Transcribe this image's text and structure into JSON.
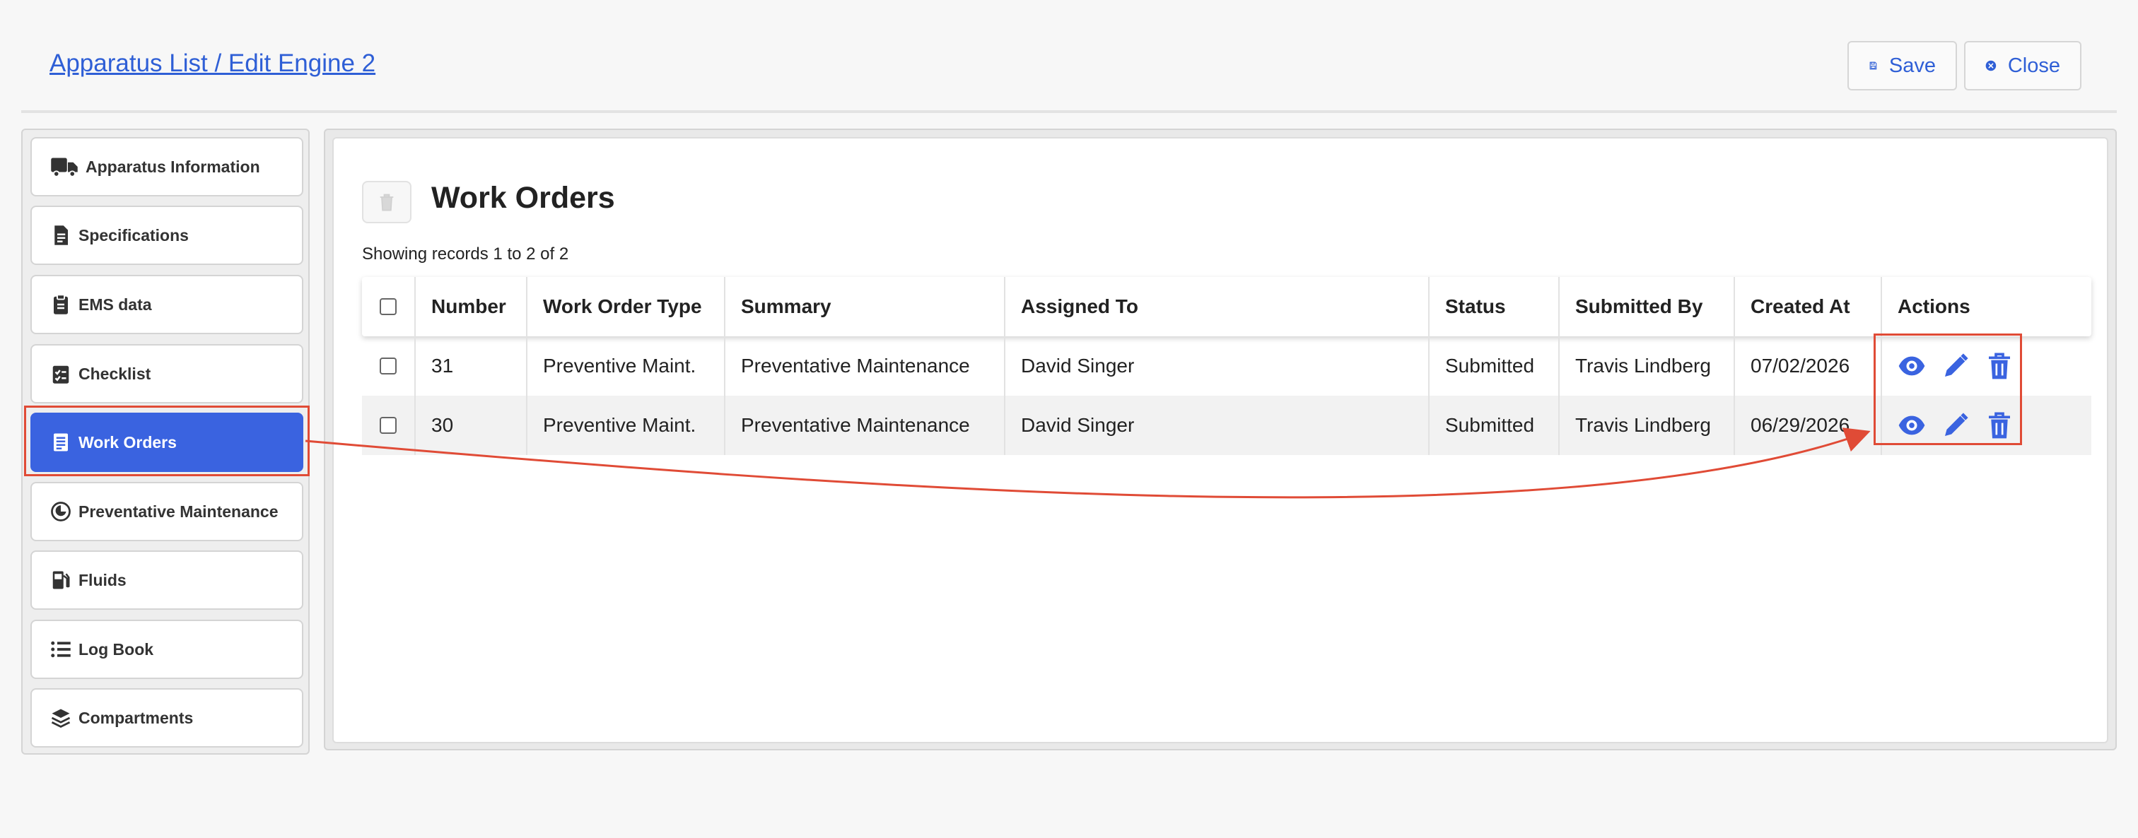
{
  "header": {
    "breadcrumb": "Apparatus List / Edit Engine 2",
    "save_label": "Save",
    "close_label": "Close"
  },
  "sidebar": {
    "items": [
      {
        "label": "Apparatus Information",
        "icon": "truck-icon"
      },
      {
        "label": "Specifications",
        "icon": "document-icon"
      },
      {
        "label": "EMS data",
        "icon": "clipboard-icon"
      },
      {
        "label": "Checklist",
        "icon": "checklist-icon"
      },
      {
        "label": "Work Orders",
        "icon": "list-doc-icon",
        "active": true
      },
      {
        "label": "Preventative Maintenance",
        "icon": "clock-icon"
      },
      {
        "label": "Fluids",
        "icon": "fuel-icon"
      },
      {
        "label": "Log Book",
        "icon": "list-icon"
      },
      {
        "label": "Compartments",
        "icon": "layers-icon"
      }
    ]
  },
  "main": {
    "title": "Work Orders",
    "record_count": "Showing records 1 to 2 of 2",
    "columns": [
      "Number",
      "Work Order Type",
      "Summary",
      "Assigned To",
      "Status",
      "Submitted By",
      "Created At",
      "Actions"
    ],
    "rows": [
      {
        "number": "31",
        "type": "Preventive Maint.",
        "summary": "Preventative Maintenance",
        "assigned": "David Singer",
        "status": "Submitted",
        "submitted_by": "Travis Lindberg",
        "created": "07/02/2026"
      },
      {
        "number": "30",
        "type": "Preventive Maint.",
        "summary": "Preventative Maintenance",
        "assigned": "David Singer",
        "status": "Submitted",
        "submitted_by": "Travis Lindberg",
        "created": "06/29/2026"
      }
    ]
  },
  "colors": {
    "accent": "#3a63e0",
    "link": "#2f5fd6",
    "annotation": "#e04b36"
  }
}
